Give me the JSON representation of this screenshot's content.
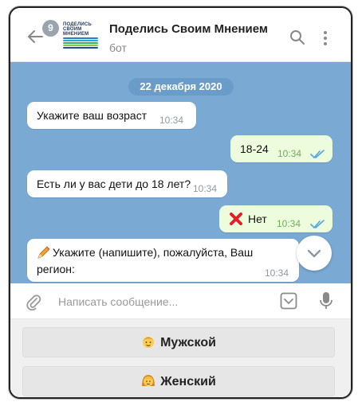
{
  "header": {
    "unread_count": "9",
    "title": "Поделись Своим Мнением",
    "subtitle": "бот",
    "logo_lines": [
      "ПОДЕЛИСЬ",
      "СВОИМ",
      "МНЕНИЕМ"
    ]
  },
  "messages": {
    "date": "22 декабря 2020",
    "items": [
      {
        "direction": "in",
        "text": "Укажите ваш возраст",
        "time": "10:34"
      },
      {
        "direction": "out",
        "text": "18-24",
        "time": "10:34"
      },
      {
        "direction": "in",
        "text": "Есть ли у вас дети до 18 лет?",
        "time": "10:34"
      },
      {
        "direction": "out",
        "icon": "red-cross-icon",
        "text": "Нет",
        "time": "10:34"
      },
      {
        "direction": "in",
        "icon": "pencil-icon",
        "text_line1": "Укажите (напишите), пожалуйста, Ваш",
        "text_line2": "регион:",
        "time": "10:34"
      }
    ]
  },
  "input": {
    "placeholder": "Написать сообщение..."
  },
  "keyboard": {
    "buttons": [
      {
        "label": "Мужской",
        "icon": "man-icon"
      },
      {
        "label": "Женский",
        "icon": "woman-icon"
      }
    ]
  },
  "colors": {
    "chat_background": "#7aa9d4",
    "outgoing_bubble": "#eefcde",
    "incoming_bubble": "#ffffff",
    "check_color": "#4fa6e0"
  }
}
